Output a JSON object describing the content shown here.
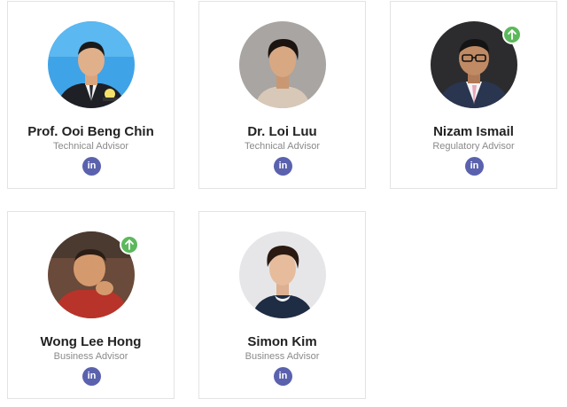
{
  "team": [
    {
      "name": "Prof. Ooi Beng Chin",
      "role": "Technical Advisor",
      "linkedin_icon": "in",
      "badge": false,
      "photo": "portrait of man in suit at podium, blue backdrop"
    },
    {
      "name": "Dr. Loi Luu",
      "role": "Technical Advisor",
      "linkedin_icon": "in",
      "badge": false,
      "photo": "portrait of young man, grey backdrop"
    },
    {
      "name": "Nizam Ismail",
      "role": "Regulatory Advisor",
      "linkedin_icon": "in",
      "badge": true,
      "photo": "portrait of man with glasses in suit, dark backdrop"
    },
    {
      "name": "Wong Lee Hong",
      "role": "Business Advisor",
      "linkedin_icon": "in",
      "badge": true,
      "photo": "portrait of man resting chin on hand, red sweater"
    },
    {
      "name": "Simon Kim",
      "role": "Business Advisor",
      "linkedin_icon": "in",
      "badge": false,
      "photo": "portrait of man in dark sweater, light backdrop"
    }
  ],
  "colors": {
    "linkedin": "#5a62ae",
    "badge": "#5cb85c",
    "card_border": "#e3e3e3",
    "name_text": "#222222",
    "role_text": "#8a8a8a"
  }
}
